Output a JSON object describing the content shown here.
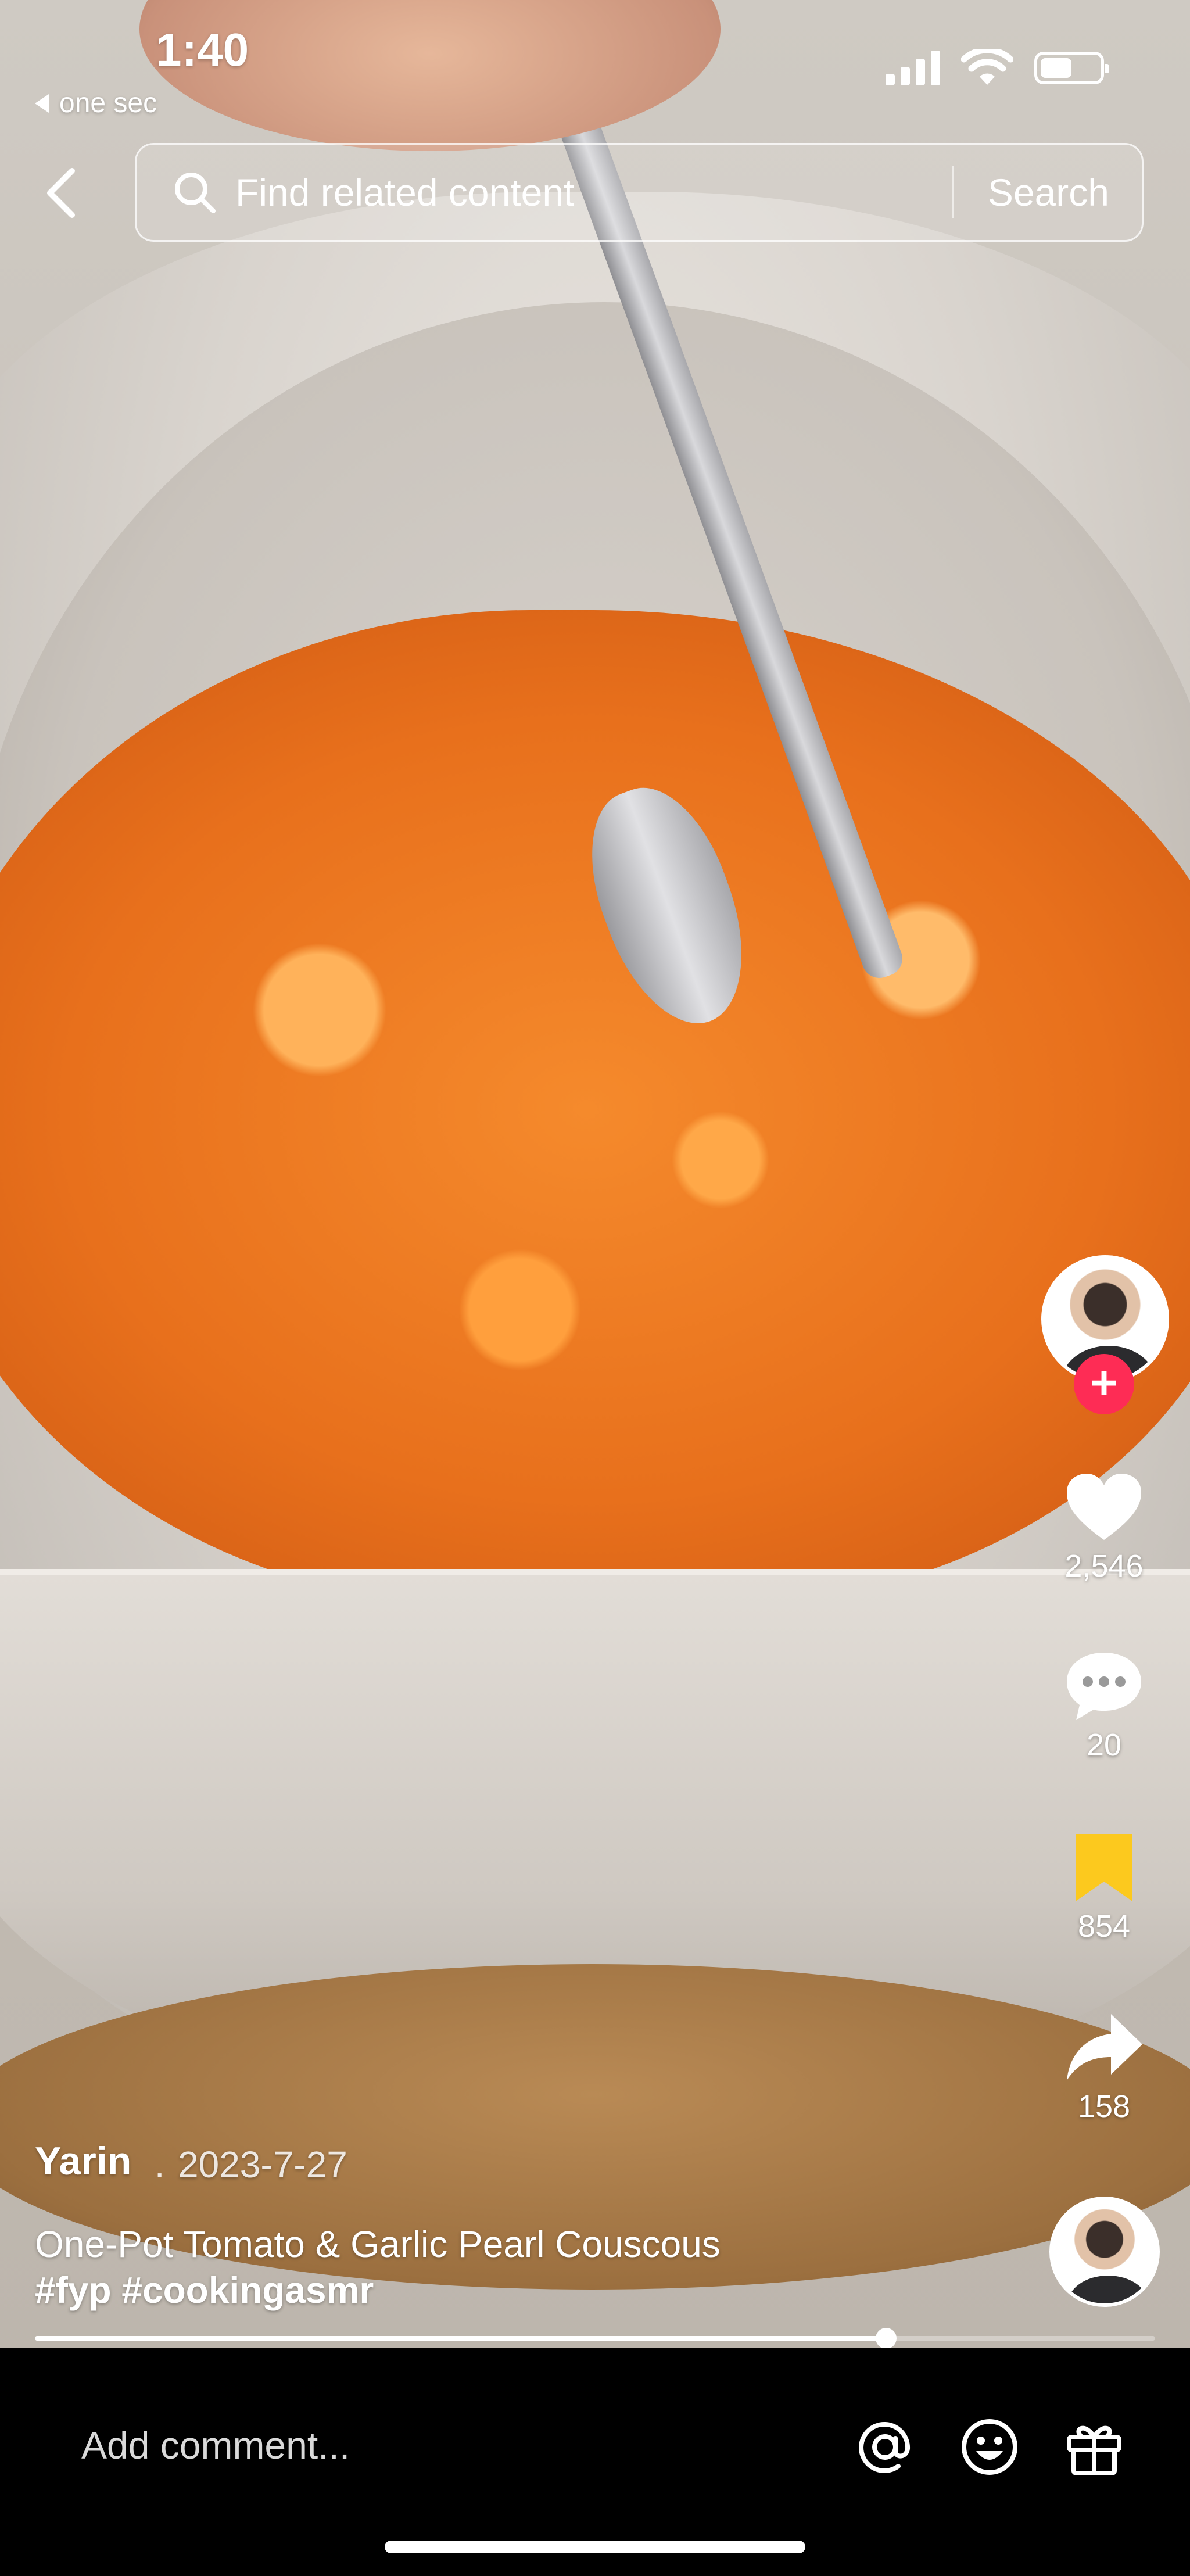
{
  "status_bar": {
    "time": "1:40",
    "back_to_app": "one sec",
    "battery_level": 0.62
  },
  "search": {
    "placeholder": "Find related content",
    "button_label": "Search"
  },
  "actions": {
    "likes": "2,546",
    "comments": "20",
    "saves": "854",
    "shares": "158"
  },
  "post": {
    "author": "Yarin",
    "separator": "·",
    "date": "2023-7-27",
    "caption": "One-Pot Tomato & Garlic Pearl Couscous",
    "hashtags": "#fyp #cookingasmr"
  },
  "playback": {
    "progress_fraction": 0.76
  },
  "comment_bar": {
    "placeholder": "Add comment..."
  },
  "colors": {
    "accent": "#fe2c55",
    "save_icon": "#fcc91e"
  }
}
